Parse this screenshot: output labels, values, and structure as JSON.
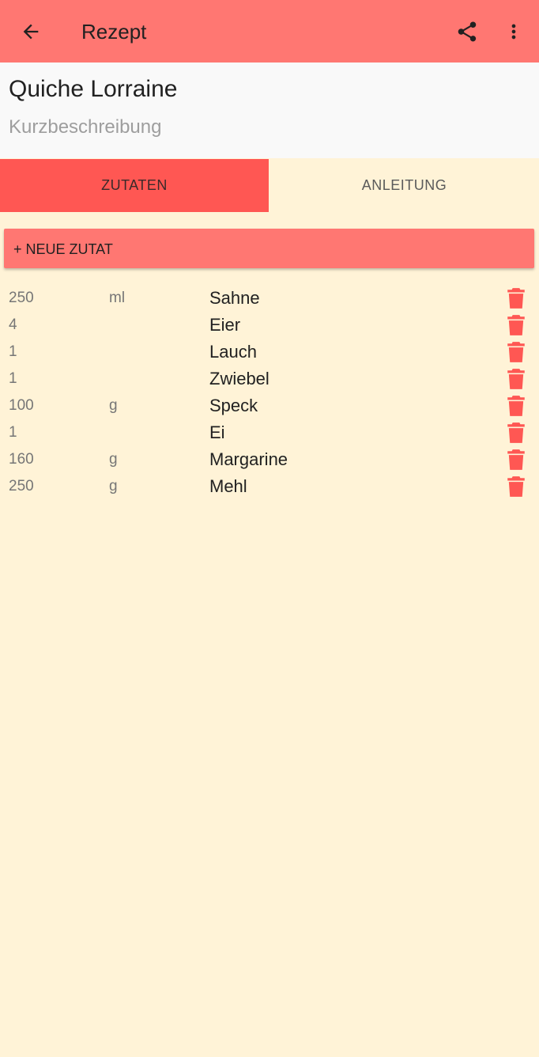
{
  "appbar": {
    "title": "Rezept",
    "back_icon": "arrow-left-icon",
    "share_icon": "share-icon",
    "more_icon": "more-vertical-icon",
    "color": "#ff7772"
  },
  "recipe": {
    "title": "Quiche Lorraine",
    "short_description_placeholder": "Kurzbeschreibung"
  },
  "tabs": [
    {
      "label": "ZUTATEN",
      "active": true
    },
    {
      "label": "ANLEITUNG",
      "active": false
    }
  ],
  "add_button": {
    "label": "+ NEUE ZUTAT"
  },
  "ingredients": [
    {
      "qty": "250",
      "unit": "ml",
      "name": "Sahne"
    },
    {
      "qty": "4",
      "unit": "",
      "name": "Eier"
    },
    {
      "qty": "1",
      "unit": "",
      "name": "Lauch"
    },
    {
      "qty": "1",
      "unit": "",
      "name": "Zwiebel"
    },
    {
      "qty": "100",
      "unit": "g",
      "name": "Speck"
    },
    {
      "qty": "1",
      "unit": "",
      "name": "Ei"
    },
    {
      "qty": "160",
      "unit": "g",
      "name": "Margarine"
    },
    {
      "qty": "250",
      "unit": "g",
      "name": "Mehl"
    }
  ],
  "colors": {
    "accent": "#ff5753",
    "appbar": "#ff7772",
    "background": "#fff3d7",
    "delete_icon": "#ff5753"
  },
  "delete_icon": "trash-icon"
}
